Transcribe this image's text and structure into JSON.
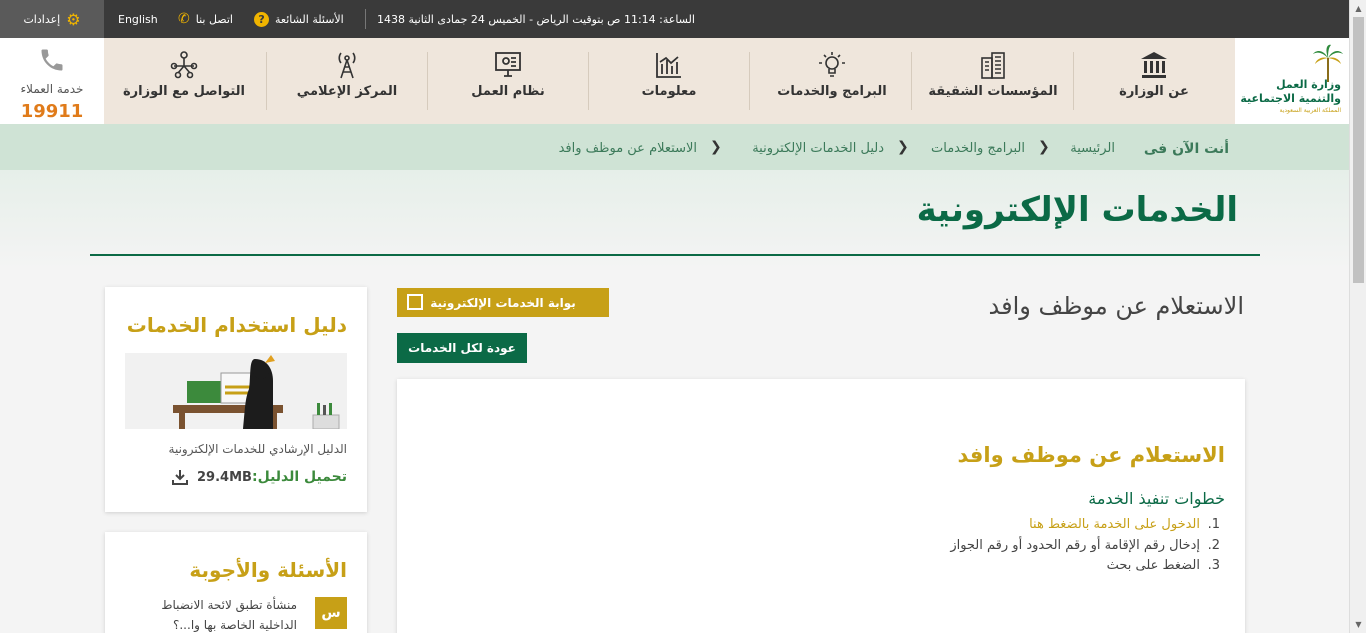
{
  "topbar": {
    "settings_label": "إعدادات",
    "language_label": "English",
    "contact_label": "اتصل بنا",
    "faq_label": "الأسئلة الشائعة",
    "datetime": "الساعة: 11:14 ص بتوقيت الرياض - الخميس 24 جمادى الثانية 1438"
  },
  "logo": {
    "line1": "وزارة العمل",
    "line2": "والتنمية الاجتماعية",
    "line3": "المملكة العربية السعودية"
  },
  "nav": {
    "items": [
      {
        "label": "عن الوزارة",
        "icon": "building-columns-icon"
      },
      {
        "label": "المؤسسات الشقيقة",
        "icon": "office-buildings-icon"
      },
      {
        "label": "البرامج والخدمات",
        "icon": "lightbulb-icon"
      },
      {
        "label": "معلومات",
        "icon": "bar-chart-icon"
      },
      {
        "label": "نظام العمل",
        "icon": "monitor-icon"
      },
      {
        "label": "المركز الإعلامي",
        "icon": "antenna-icon"
      },
      {
        "label": "التواصل مع الوزارة",
        "icon": "people-network-icon"
      }
    ],
    "customer_service_label": "خدمة العملاء",
    "customer_service_number": "19911"
  },
  "breadcrumb": {
    "prefix": "أنت الآن فى",
    "items": [
      "الرئيسية",
      "البرامج والخدمات",
      "دليل الخدمات الإلكترونية",
      "الاستعلام عن موظف وافد"
    ]
  },
  "page": {
    "title": "الخدمات الإلكترونية",
    "service_heading": "الاستعلام عن موظف وافد",
    "portal_button": "بوابة الخدمات الإلكترونية",
    "back_button": "عودة لكل الخدمات"
  },
  "card": {
    "title": "الاستعلام عن موظف وافد",
    "steps_title": "خطوات تنفيذ الخدمة",
    "steps": [
      {
        "num": "1.",
        "text": "الدخول على الخدمة بالضغط هنا"
      },
      {
        "num": "2.",
        "text": "إدخال رقم الإقامة أو رقم الحدود أو رقم الجواز"
      },
      {
        "num": "3.",
        "text": "الضغط على بحث"
      }
    ]
  },
  "sidebar": {
    "guide_title": "دليل استخدام الخدمات",
    "guide_desc": "الدليل الإرشادي للخدمات الإلكترونية",
    "download_label": "تحميل الدليل:",
    "download_size": "29.4MB",
    "faq_title": "الأسئلة والأجوبة",
    "faq_badge": "س",
    "faq_question": "منشأة تطبق لائحة الانضباط الداخلية الخاصة بها وا...؟"
  },
  "colors": {
    "green": "#0b6a46",
    "gold": "#c7a017",
    "topbar": "#3a3a3a",
    "nav_bg": "#efe6dc"
  }
}
